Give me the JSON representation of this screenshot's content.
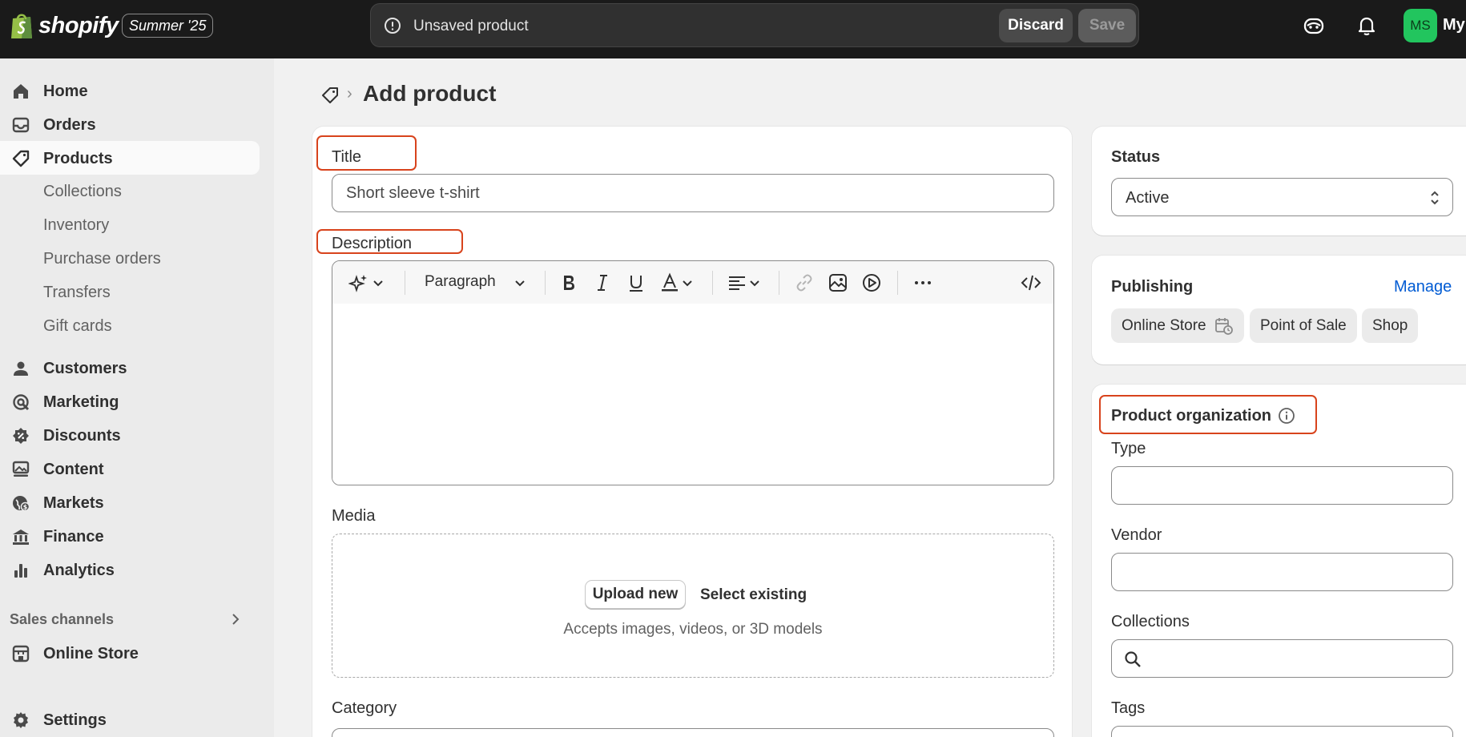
{
  "topbar": {
    "brand": "shopify",
    "edition": "Summer '25",
    "status_message": "Unsaved product",
    "discard_label": "Discard",
    "save_label": "Save",
    "avatar_initials": "MS",
    "store_name": "My",
    "avatar_color": "#22c55e"
  },
  "sidebar": {
    "items": [
      {
        "label": "Home",
        "icon": "home-icon"
      },
      {
        "label": "Orders",
        "icon": "inbox-icon"
      },
      {
        "label": "Products",
        "icon": "tag-icon"
      },
      {
        "label": "Customers",
        "icon": "person-icon"
      },
      {
        "label": "Marketing",
        "icon": "target-icon"
      },
      {
        "label": "Discounts",
        "icon": "discount-icon"
      },
      {
        "label": "Content",
        "icon": "image-icon"
      },
      {
        "label": "Markets",
        "icon": "globe-icon"
      },
      {
        "label": "Finance",
        "icon": "bank-icon"
      },
      {
        "label": "Analytics",
        "icon": "bar-chart-icon"
      }
    ],
    "product_subitems": [
      "Collections",
      "Inventory",
      "Purchase orders",
      "Transfers",
      "Gift cards"
    ],
    "sales_channels_label": "Sales channels",
    "online_store_label": "Online Store",
    "settings_label": "Settings",
    "active_item": "Products"
  },
  "main": {
    "page_title": "Add product",
    "title_label": "Title",
    "title_placeholder": "Short sleeve t-shirt",
    "description_label": "Description",
    "paragraph_label": "Paragraph",
    "media_label": "Media",
    "upload_new_label": "Upload new",
    "select_existing_label": "Select existing",
    "media_hint": "Accepts images, videos, or 3D models",
    "category_label": "Category"
  },
  "right": {
    "status_title": "Status",
    "status_value": "Active",
    "publishing_title": "Publishing",
    "manage_label": "Manage",
    "channels": [
      "Online Store",
      "Point of Sale",
      "Shop"
    ],
    "org_title": "Product organization",
    "type_label": "Type",
    "vendor_label": "Vendor",
    "collections_label": "Collections",
    "tags_label": "Tags"
  },
  "colors": {
    "highlight": "#d8431c",
    "link": "#005bd3"
  }
}
